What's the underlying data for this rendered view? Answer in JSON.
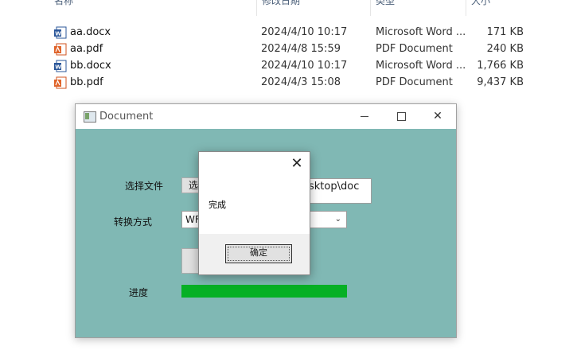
{
  "explorer": {
    "columns": [
      "名称",
      "修改日期",
      "类型",
      "大小"
    ],
    "files": [
      {
        "name": "aa.docx",
        "date": "2024/4/10 10:17",
        "type": "Microsoft Word ...",
        "size": "171 KB",
        "icon": "word-icon"
      },
      {
        "name": "aa.pdf",
        "date": "2024/4/8 15:59",
        "type": "PDF Document",
        "size": "240 KB",
        "icon": "pdf-icon"
      },
      {
        "name": "bb.docx",
        "date": "2024/4/10 10:17",
        "type": "Microsoft Word ...",
        "size": "1,766 KB",
        "icon": "word-icon"
      },
      {
        "name": "bb.pdf",
        "date": "2024/4/3 15:08",
        "type": "PDF Document",
        "size": "9,437 KB",
        "icon": "pdf-icon"
      }
    ]
  },
  "window": {
    "title": "Document",
    "labels": {
      "select_file": "选择文件",
      "convert_mode": "转换方式",
      "progress": "进度"
    },
    "select_button_label": "选",
    "path_value": "esktop\\doc",
    "mode_value": "WF",
    "progress_value": 1.0,
    "progress_color": "#06b025"
  },
  "dialog": {
    "message": "完成",
    "ok_label": "确定",
    "close_glyph": "✕"
  }
}
